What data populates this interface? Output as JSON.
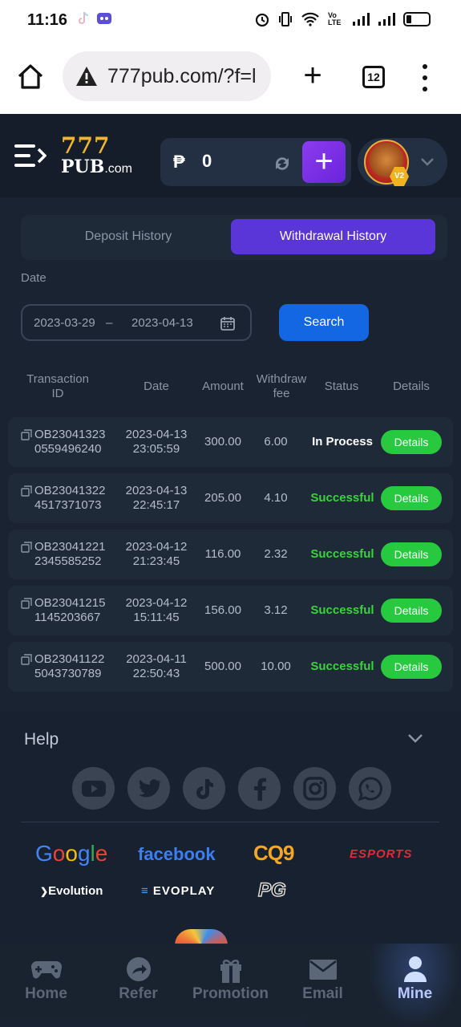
{
  "status_bar": {
    "time": "11:16",
    "network": "Vo LTE"
  },
  "browser": {
    "url": "777pub.com/?f=l",
    "tab_count": "12"
  },
  "header": {
    "logo_top": "777",
    "logo_bottom": "PUB",
    "logo_suffix": ".com",
    "currency": "₱",
    "balance": "0",
    "add_label": "+",
    "vip_badge": "V2"
  },
  "tabs": {
    "deposit": "Deposit History",
    "withdrawal": "Withdrawal History",
    "active": "withdrawal"
  },
  "filter": {
    "date_label": "Date",
    "from": "2023-03-29",
    "separator": "–",
    "to": "2023-04-13",
    "search_label": "Search"
  },
  "table": {
    "columns": [
      "Transaction ID",
      "Date",
      "Amount",
      "Withdraw fee",
      "Status",
      "Details"
    ],
    "rows": [
      {
        "id1": "OB23041323",
        "id2": "0559496240",
        "date1": "2023-04-13",
        "date2": "23:05:59",
        "amount": "300.00",
        "fee": "6.00",
        "status": "In Process",
        "details": "Details"
      },
      {
        "id1": "OB23041322",
        "id2": "4517371073",
        "date1": "2023-04-13",
        "date2": "22:45:17",
        "amount": "205.00",
        "fee": "4.10",
        "status": "Successful",
        "details": "Details"
      },
      {
        "id1": "OB23041221",
        "id2": "2345585252",
        "date1": "2023-04-12",
        "date2": "21:23:45",
        "amount": "116.00",
        "fee": "2.32",
        "status": "Successful",
        "details": "Details"
      },
      {
        "id1": "OB23041215",
        "id2": "1145203667",
        "date1": "2023-04-12",
        "date2": "15:11:45",
        "amount": "156.00",
        "fee": "3.12",
        "status": "Successful",
        "details": "Details"
      },
      {
        "id1": "OB23041122",
        "id2": "5043730789",
        "date1": "2023-04-11",
        "date2": "22:50:43",
        "amount": "500.00",
        "fee": "10.00",
        "status": "Successful",
        "details": "Details"
      }
    ]
  },
  "help": {
    "title": "Help",
    "socials": [
      "youtube-icon",
      "twitter-icon",
      "tiktok-icon",
      "facebook-icon",
      "instagram-icon",
      "whatsapp-icon"
    ],
    "partners": {
      "google": "Google",
      "facebook": "facebook",
      "cq9": "CQ9",
      "esports": "ESPORTS",
      "evolution": "Evolution",
      "evoplay": "EVOPLAY",
      "pg": "PG"
    }
  },
  "nav": {
    "items": [
      {
        "label": "Home",
        "icon": "gamepad-icon"
      },
      {
        "label": "Refer",
        "icon": "share-icon"
      },
      {
        "label": "Promotion",
        "icon": "gift-icon"
      },
      {
        "label": "Email",
        "icon": "mail-icon"
      },
      {
        "label": "Mine",
        "icon": "user-icon"
      }
    ],
    "active": "Mine"
  },
  "colors": {
    "accent_purple": "#5a35d8",
    "search_blue": "#1467e2",
    "success_green": "#27c93f",
    "bg": "#1a2331"
  }
}
